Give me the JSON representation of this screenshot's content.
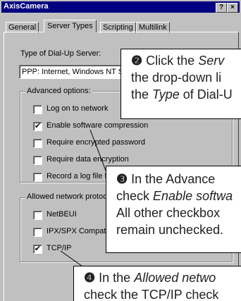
{
  "window": {
    "title": "AxisCamera",
    "help_btn": "?",
    "close_btn": "×"
  },
  "tabs": [
    {
      "label": "General"
    },
    {
      "label": "Server Types"
    },
    {
      "label": "Scripting"
    },
    {
      "label": "Multilink"
    }
  ],
  "dialup": {
    "label": "Type of Dial-Up Server:",
    "value": "PPP: Internet, Windows NT S"
  },
  "advanced": {
    "legend": "Advanced options:",
    "items": [
      {
        "label": "Log on to network",
        "checked": ""
      },
      {
        "label": "Enable software compression",
        "checked": "✔"
      },
      {
        "label": "Require encrypted password",
        "checked": ""
      },
      {
        "label": "Require data encryption",
        "checked": ""
      },
      {
        "label": "Record a log file for",
        "checked": ""
      }
    ]
  },
  "protocols": {
    "legend": "Allowed network protocols:",
    "items": [
      {
        "label": "NetBEUI",
        "checked": ""
      },
      {
        "label": "IPX/SPX Compatible",
        "checked": ""
      },
      {
        "label": "TCP/IP",
        "checked": "✔"
      }
    ]
  },
  "callouts": {
    "c2": {
      "num": "❷",
      "l1a": "Click the ",
      "l1b": "Serv",
      "l2": "the drop-down li",
      "l3a": "the ",
      "l3b": "Type",
      "l3c": " of Dial-U"
    },
    "c3": {
      "num": "❸",
      "l1": "In the Advance",
      "l2a": "check ",
      "l2b": "Enable softwa",
      "l3": "All other checkbox",
      "l4": "remain unchecked."
    },
    "c4": {
      "num": "❹",
      "l1a": "In the ",
      "l1b": "Allowed netwo",
      "l2": "check the TCP/IP check"
    }
  }
}
